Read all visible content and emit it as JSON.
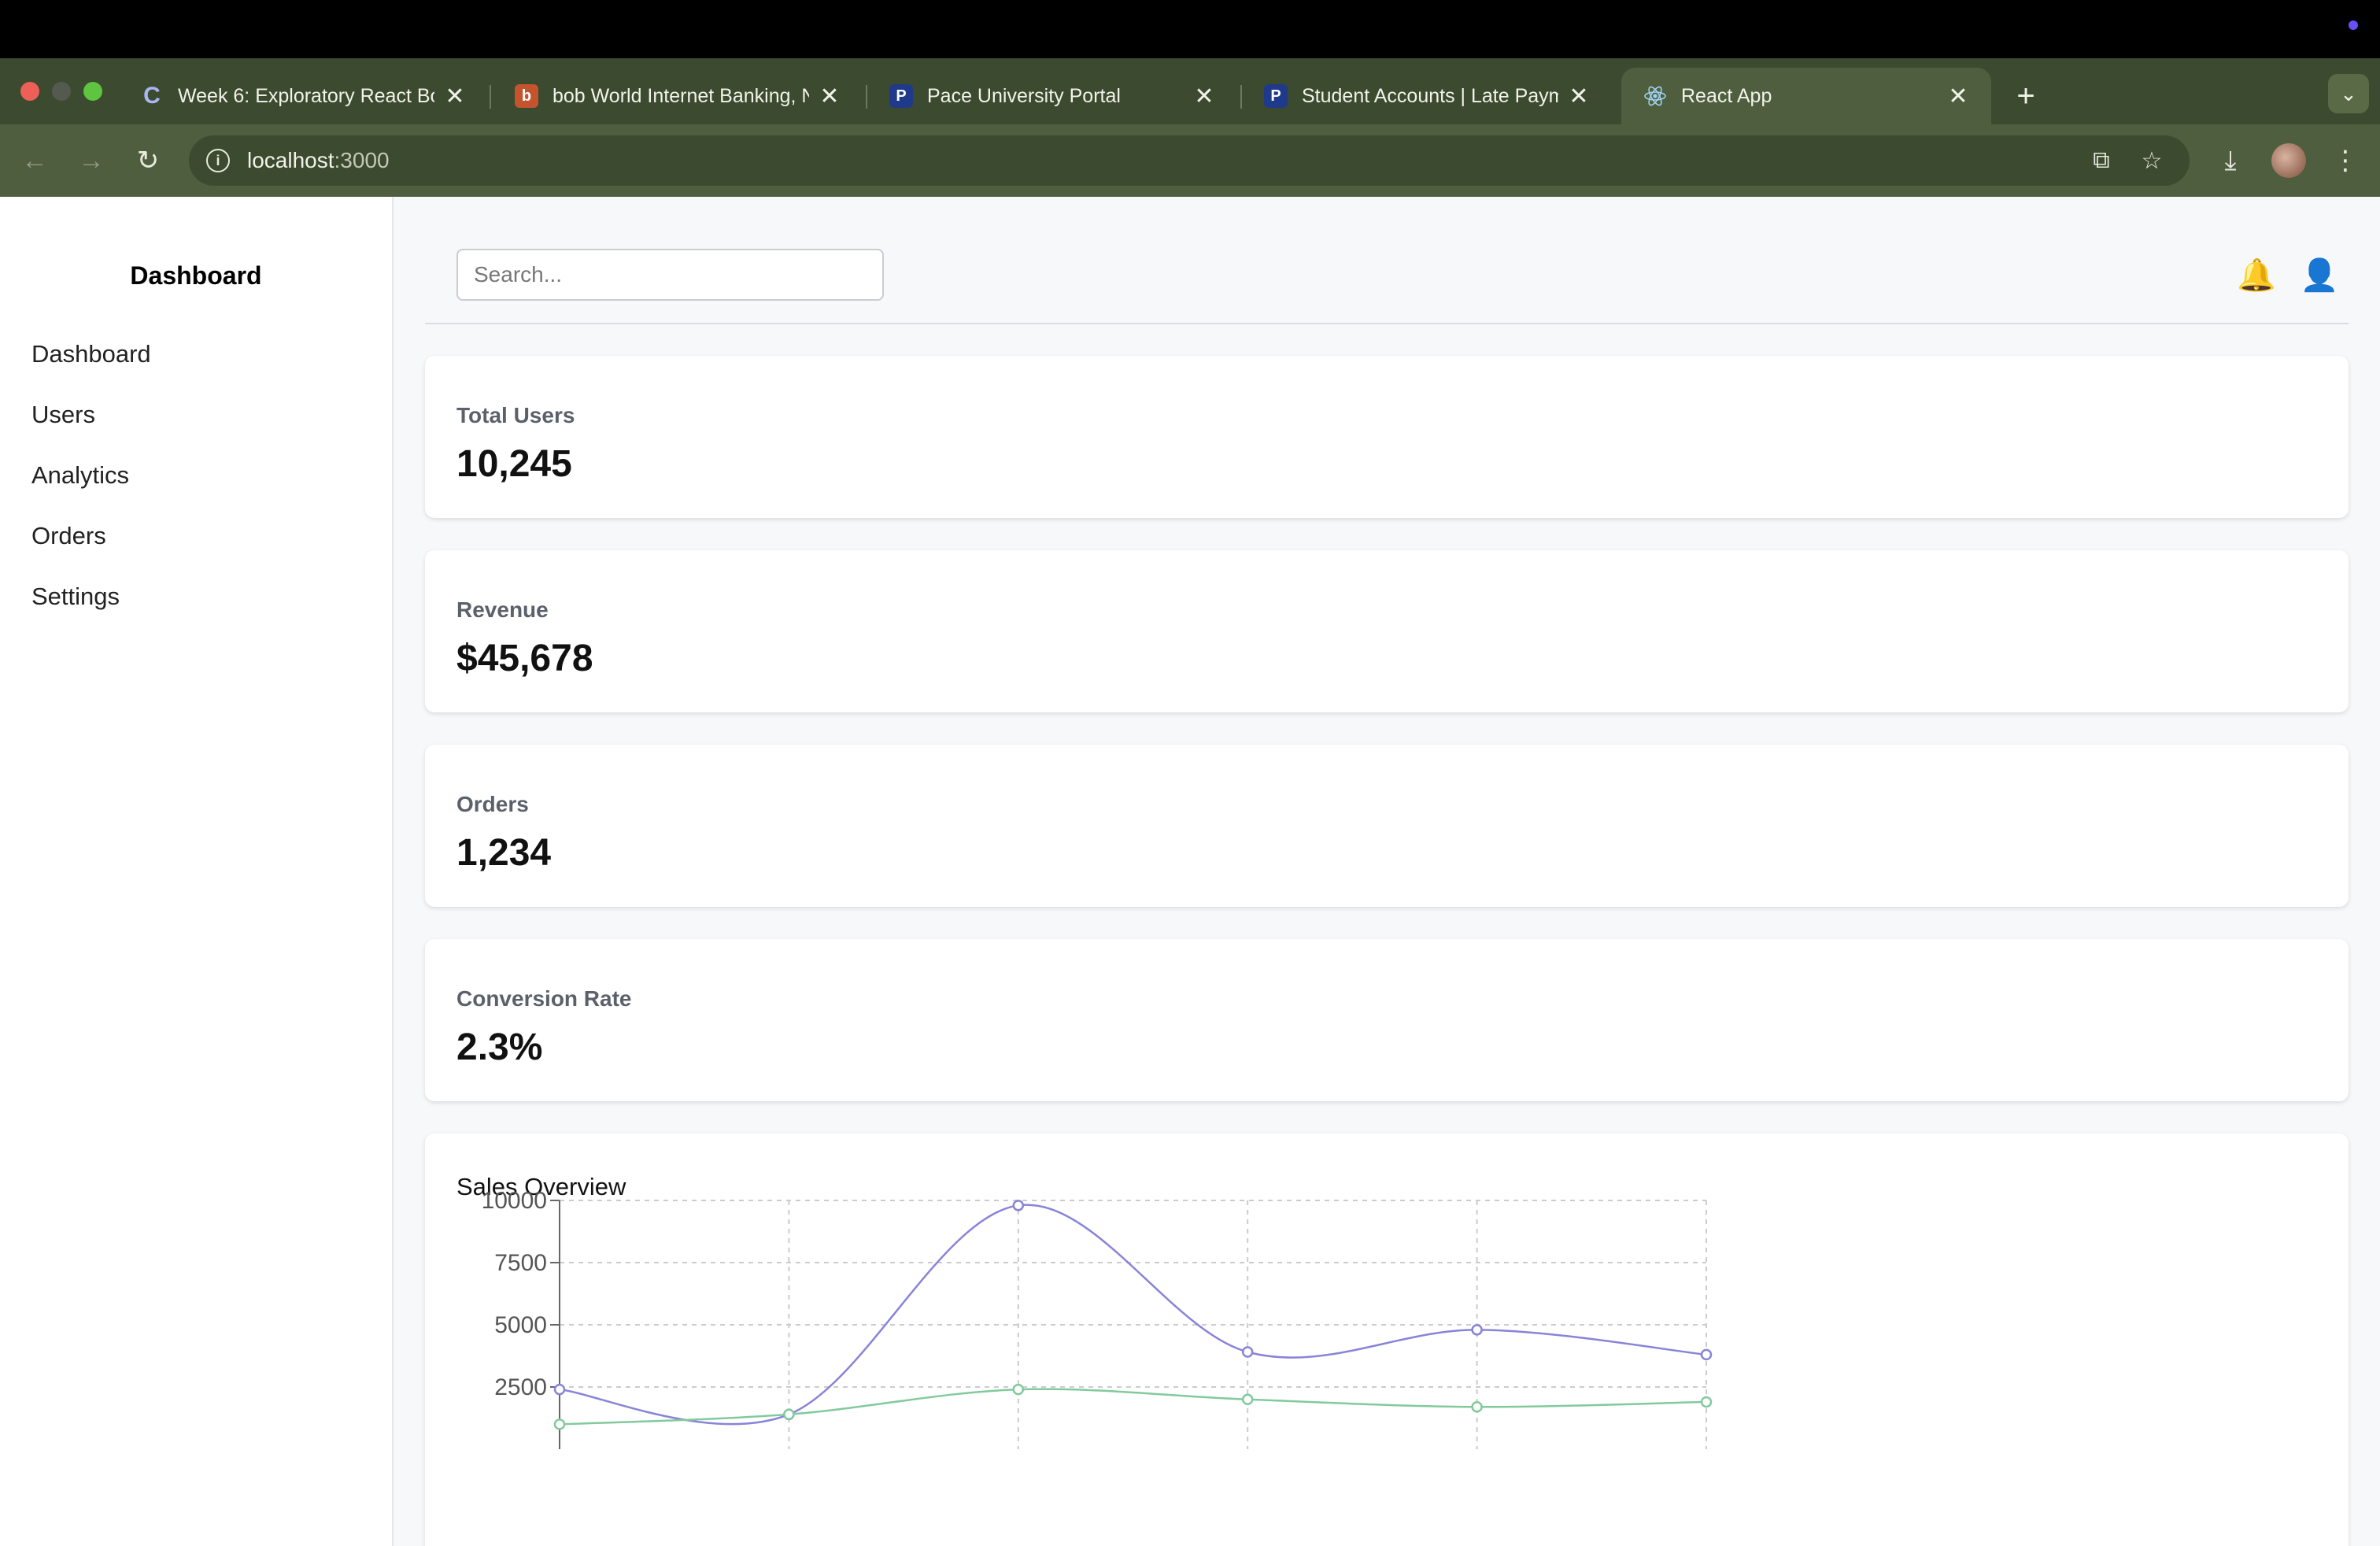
{
  "browser": {
    "tabs": [
      {
        "title": "Week 6: Exploratory React Bo",
        "favicon": "C"
      },
      {
        "title": "bob World Internet Banking, N",
        "favicon": "b"
      },
      {
        "title": "Pace University Portal",
        "favicon": "P"
      },
      {
        "title": "Student Accounts | Late Paym",
        "favicon": "P"
      },
      {
        "title": "React App",
        "favicon": "react-icon"
      }
    ],
    "url_host": "localhost",
    "url_port": ":3000",
    "close_glyph": "✕",
    "new_tab_glyph": "+"
  },
  "sidebar": {
    "title": "Dashboard",
    "items": [
      {
        "label": "Dashboard"
      },
      {
        "label": "Users"
      },
      {
        "label": "Analytics"
      },
      {
        "label": "Orders"
      },
      {
        "label": "Settings"
      }
    ]
  },
  "header": {
    "search_placeholder": "Search...",
    "bell_icon": "🔔",
    "user_icon": "👤"
  },
  "stats": [
    {
      "label": "Total Users",
      "value": "10,245"
    },
    {
      "label": "Revenue",
      "value": "$45,678"
    },
    {
      "label": "Orders",
      "value": "1,234"
    },
    {
      "label": "Conversion Rate",
      "value": "2.3%"
    }
  ],
  "chart_title": "Sales Overview",
  "chart_data": {
    "type": "line",
    "title": "Sales Overview",
    "x": [
      0,
      1,
      2,
      3,
      4,
      5
    ],
    "ylim": [
      0,
      10000
    ],
    "yticks": [
      2500,
      5000,
      7500,
      10000
    ],
    "grid": true,
    "series": [
      {
        "color": "#8884d8",
        "values": [
          2400,
          1398,
          9800,
          3908,
          4800,
          3800
        ]
      },
      {
        "color": "#82ca9d",
        "values": [
          1000,
          1400,
          2400,
          2000,
          1700,
          1900
        ]
      }
    ]
  }
}
